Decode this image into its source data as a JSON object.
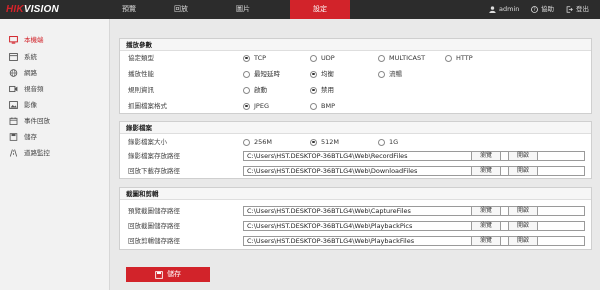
{
  "brand": {
    "logo_left": "HIK",
    "logo_right": "VISION"
  },
  "nav": {
    "tabs": [
      "預覽",
      "回放",
      "圖片",
      "設定"
    ],
    "active_tab": 3,
    "user": "admin",
    "help": "協助",
    "logout": "登出"
  },
  "sidebar": {
    "items": [
      {
        "label": "本機端",
        "icon": "monitor-icon",
        "active": true
      },
      {
        "label": "系統",
        "icon": "system-icon",
        "active": false
      },
      {
        "label": "網路",
        "icon": "globe-icon",
        "active": false
      },
      {
        "label": "視音頻",
        "icon": "video-audio-icon",
        "active": false
      },
      {
        "label": "影像",
        "icon": "image-icon",
        "active": false
      },
      {
        "label": "事件回放",
        "icon": "calendar-icon",
        "active": false
      },
      {
        "label": "儲存",
        "icon": "storage-icon",
        "active": false
      },
      {
        "label": "道路監控",
        "icon": "road-icon",
        "active": false
      }
    ]
  },
  "playback": {
    "title": "播放參數",
    "protocol": {
      "label": "協定類型",
      "options": [
        "TCP",
        "UDP",
        "MULTICAST",
        "HTTP"
      ],
      "selected": 0
    },
    "performance": {
      "label": "播放性能",
      "options": [
        "最短延時",
        "均衡",
        "流暢"
      ],
      "selected": 1
    },
    "rules": {
      "label": "規則資訊",
      "options": [
        "啟動",
        "禁用"
      ],
      "selected": 1
    },
    "image_format": {
      "label": "抓圖檔案格式",
      "options": [
        "JPEG",
        "BMP"
      ],
      "selected": 0
    }
  },
  "recording": {
    "title": "錄影檔案",
    "file_size": {
      "label": "錄影檔案大小",
      "options": [
        "256M",
        "512M",
        "1G"
      ],
      "selected": 1
    },
    "save_path": {
      "label": "錄影檔案存放路徑",
      "value": "C:\\Users\\HST.DESKTOP-36BTLG4\\Web\\RecordFiles"
    },
    "download_path": {
      "label": "回放下載存放路徑",
      "value": "C:\\Users\\HST.DESKTOP-36BTLG4\\Web\\DownloadFiles"
    }
  },
  "snapshot": {
    "title": "截圖和剪輯",
    "preview_snapshot": {
      "label": "預覽截圖儲存路徑",
      "value": "C:\\Users\\HST.DESKTOP-36BTLG4\\Web\\CaptureFiles"
    },
    "playback_snapshot": {
      "label": "回放截圖儲存路徑",
      "value": "C:\\Users\\HST.DESKTOP-36BTLG4\\Web\\PlaybackPics"
    },
    "playback_clip": {
      "label": "回放剪輯儲存路徑",
      "value": "C:\\Users\\HST.DESKTOP-36BTLG4\\Web\\PlaybackFiles"
    }
  },
  "buttons": {
    "browse": "瀏覽",
    "open": "開啟",
    "save": "儲存"
  },
  "colors": {
    "accent": "#d2232a",
    "topbar": "#2c2c2c"
  }
}
